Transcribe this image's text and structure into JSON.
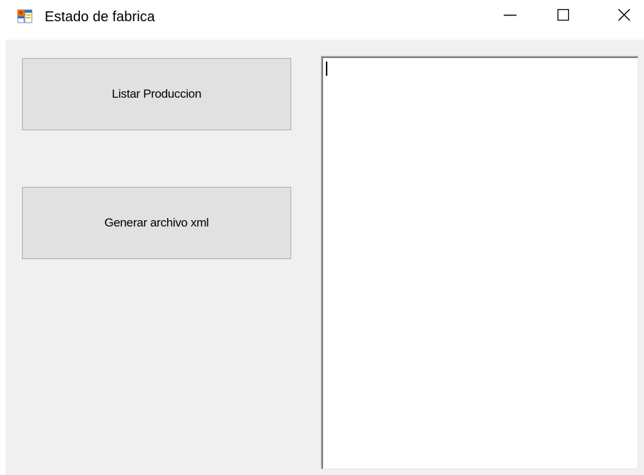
{
  "window": {
    "title": "Estado de fabrica",
    "icon": "winforms-app-icon",
    "controls": {
      "minimize": "minimize-icon",
      "maximize": "maximize-icon",
      "close": "close-icon"
    }
  },
  "buttons": {
    "listar_label": "Listar Produccion",
    "generar_label": "Generar archivo xml"
  },
  "output": {
    "value": ""
  },
  "colors": {
    "client_bg": "#f0f0f0",
    "button_bg": "#e1e1e1",
    "button_border": "#adadad",
    "textbox_bg": "#ffffff"
  }
}
